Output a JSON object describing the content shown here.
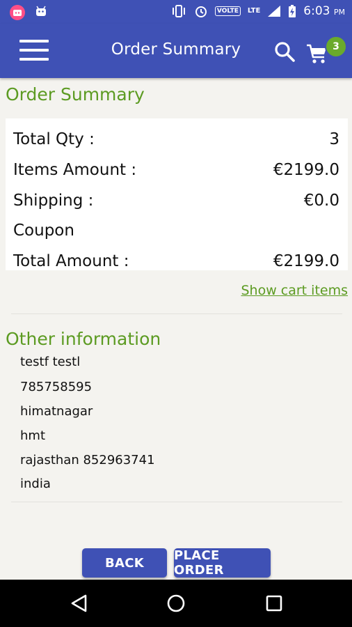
{
  "status_bar": {
    "time": "6:03",
    "ampm": "PM",
    "volte": "VOLTE",
    "lte": "LTE",
    "icons": [
      "app-notification-icon",
      "android-icon",
      "vibrate-icon",
      "alarm-icon",
      "volte-icon",
      "lte-icon",
      "signal-icon",
      "battery-charging-icon"
    ]
  },
  "app_bar": {
    "title": "Order Summary",
    "menu_icon": "hamburger-menu-icon",
    "search_icon": "search-icon",
    "cart_icon": "cart-icon",
    "cart_count": "3",
    "primary_color": "#3f51b5",
    "badge_color": "#6aaa2c"
  },
  "summary": {
    "heading": "Order Summary",
    "rows": [
      {
        "label": "Total Qty :",
        "value": "3"
      },
      {
        "label": "Items Amount :",
        "value": "€2199.0"
      },
      {
        "label": "Shipping :",
        "value": "€0.0"
      },
      {
        "label": "Coupon",
        "value": ""
      },
      {
        "label": "Total Amount :",
        "value": "€2199.0"
      }
    ],
    "show_cart_link": "Show cart items",
    "heading_color": "#5c9b22"
  },
  "other_info": {
    "heading": "Other information",
    "lines": [
      "testf testl",
      "785758595",
      "himatnagar",
      "hmt",
      "rajasthan  852963741",
      "india"
    ]
  },
  "actions": {
    "back_label": "BACK",
    "place_order_label": "PLACE ORDER"
  },
  "nav_bar": {
    "back_icon": "nav-back-icon",
    "home_icon": "nav-home-icon",
    "recents_icon": "nav-recents-icon"
  }
}
